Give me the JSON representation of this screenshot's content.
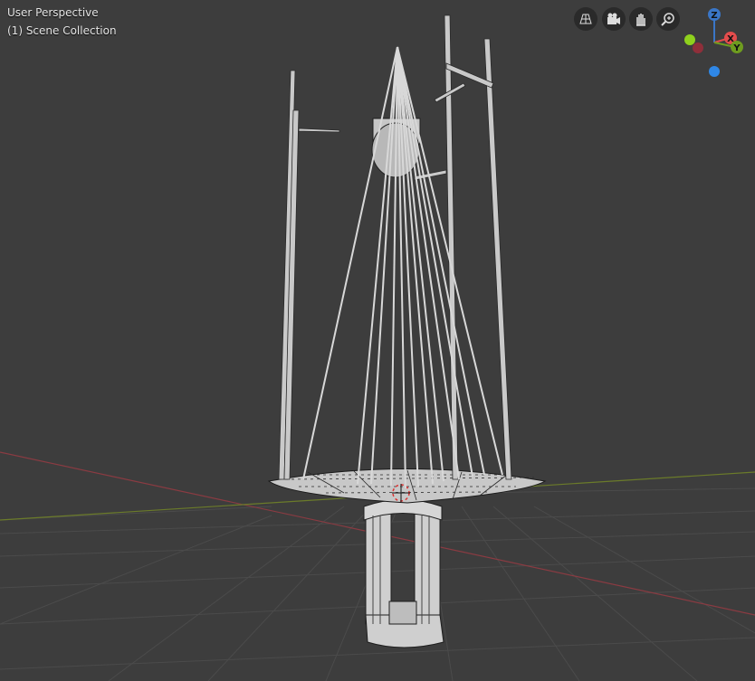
{
  "viewport": {
    "view_label": "User Perspective",
    "collection_label": "(1) Scene Collection"
  },
  "navigation": {
    "buttons": [
      {
        "name": "perspective-toggle",
        "icon": "grid-icon"
      },
      {
        "name": "camera-view",
        "icon": "camera-icon"
      },
      {
        "name": "pan-view",
        "icon": "hand-icon"
      },
      {
        "name": "zoom-view",
        "icon": "zoom-icon"
      }
    ]
  },
  "gizmo": {
    "z_label": "Z",
    "x_label": "X",
    "y_label": "Y",
    "colors": {
      "x": "#e34c4c",
      "y": "#6e9c1f",
      "z": "#3a76c7",
      "neg_x": "#8f2f3a",
      "neg_y": "#8fd11d",
      "neg_z": "#2f87e6"
    }
  },
  "colors": {
    "background": "#3d3d3d",
    "grid": "#4a4a4a",
    "x_axis": "#8a3b42",
    "y_axis": "#6b7b2a",
    "mesh": "#d8d8d8",
    "mesh_dark": "#1f1f1f"
  }
}
